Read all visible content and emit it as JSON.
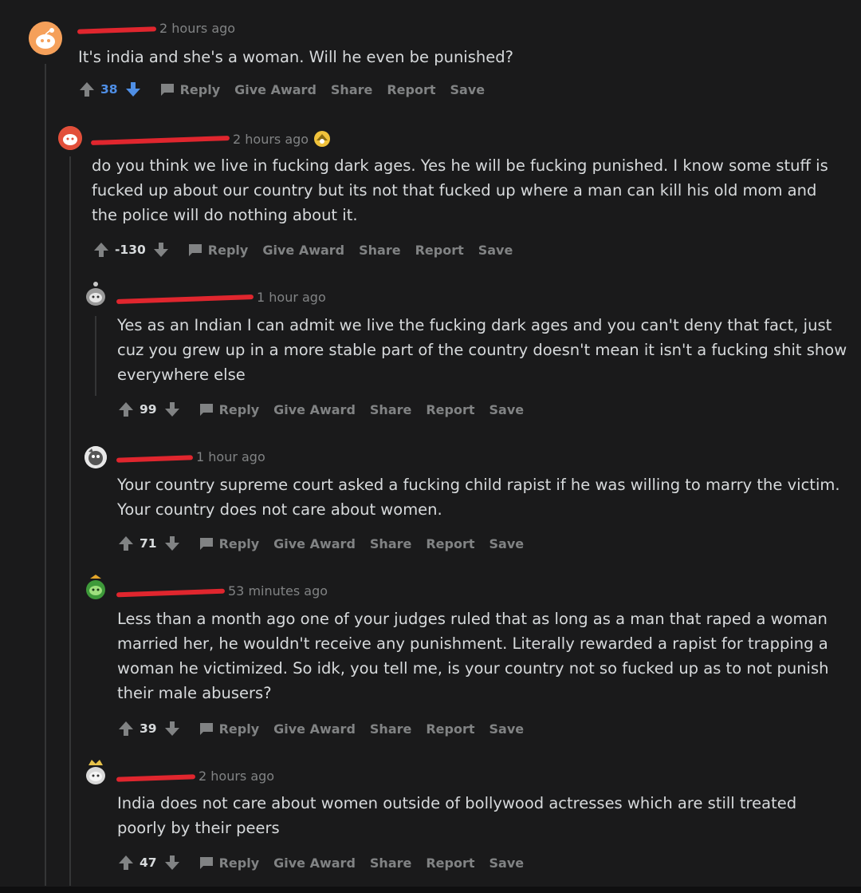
{
  "comments": [
    {
      "time": "2 hours ago",
      "body": "It's india and she's a woman. Will he even be punished?",
      "score": "38",
      "score_color": "#4f8fe6",
      "actions": [
        "Reply",
        "Give Award",
        "Share",
        "Report",
        "Save"
      ]
    },
    {
      "time": "2 hours ago",
      "body": "do you think we live in fucking dark ages. Yes he will be fucking punished. I know some stuff is fucked up about our country but its not that fucked up where a man can kill his old mom and the police will do nothing about it.",
      "score": "-130",
      "actions": [
        "Reply",
        "Give Award",
        "Share",
        "Report",
        "Save"
      ]
    },
    {
      "time": "1 hour ago",
      "body": "Yes as an Indian I can admit we live the fucking dark ages and you can't deny that fact, just cuz you grew up in a more stable part of the country doesn't mean it isn't a fucking shit show everywhere else",
      "score": "99",
      "actions": [
        "Reply",
        "Give Award",
        "Share",
        "Report",
        "Save"
      ]
    },
    {
      "time": "1 hour ago",
      "body": "Your country supreme court asked a fucking child rapist if he was willing to marry the victim. Your country does not care about women.",
      "score": "71",
      "actions": [
        "Reply",
        "Give Award",
        "Share",
        "Report",
        "Save"
      ]
    },
    {
      "time": "53 minutes ago",
      "body": "Less than a month ago one of your judges ruled that as long as a man that raped a woman married her, he wouldn't receive any punishment. Literally rewarded a rapist for trapping a woman he victimized. So idk, you tell me, is your country not so fucked up as to not punish their male abusers?",
      "score": "39",
      "actions": [
        "Reply",
        "Give Award",
        "Share",
        "Report",
        "Save"
      ]
    },
    {
      "time": "2 hours ago",
      "body": "India does not care about women outside of bollywood actresses which are still treated poorly by their peers",
      "score": "47",
      "actions": [
        "Reply",
        "Give Award",
        "Share",
        "Report",
        "Save"
      ]
    }
  ],
  "colors": {
    "background": "#1a1a1b",
    "text": "#d7dadc",
    "muted": "#818384",
    "redaction": "#e0262e",
    "upvote_blue": "#4f8fe6"
  },
  "icons": {
    "upvote": "arrow-up-icon",
    "downvote": "arrow-down-icon",
    "reply": "chat-bubble-icon",
    "award": "award-emoji-icon"
  }
}
